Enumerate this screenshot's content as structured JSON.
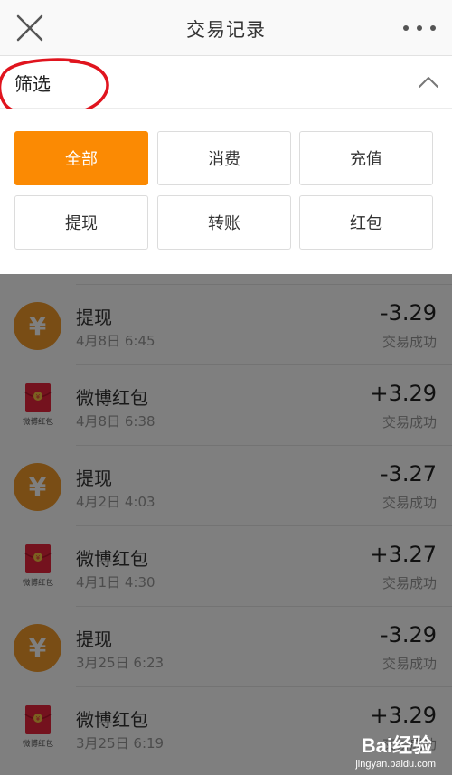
{
  "navbar": {
    "title": "交易记录",
    "close_icon": "close-icon",
    "more_icon": "more-dots-icon"
  },
  "filter": {
    "label": "筛选",
    "toggle_icon": "chevron-up-icon",
    "options": [
      "全部",
      "消费",
      "充值",
      "提现",
      "转账",
      "红包"
    ],
    "selected": "全部",
    "accent_color": "#fb8a03"
  },
  "transactions": [
    {
      "icon": "yen-icon",
      "name": "提现",
      "time": "4月8日 6:45",
      "amount": "-3.29",
      "status": "交易成功"
    },
    {
      "icon": "red-packet-icon",
      "icon_text": "微博红包",
      "name": "微博红包",
      "time": "4月8日 6:38",
      "amount": "+3.29",
      "status": "交易成功"
    },
    {
      "icon": "yen-icon",
      "name": "提现",
      "time": "4月2日 4:03",
      "amount": "-3.27",
      "status": "交易成功"
    },
    {
      "icon": "red-packet-icon",
      "icon_text": "微博红包",
      "name": "微博红包",
      "time": "4月1日 4:30",
      "amount": "+3.27",
      "status": "交易成功"
    },
    {
      "icon": "yen-icon",
      "name": "提现",
      "time": "3月25日 6:23",
      "amount": "-3.29",
      "status": "交易成功"
    },
    {
      "icon": "red-packet-icon",
      "icon_text": "微博红包",
      "name": "微博红包",
      "time": "3月25日 6:19",
      "amount": "+3.29",
      "status": "交易成功"
    }
  ],
  "watermark": {
    "logo_text": "Bai经验",
    "url": "jingyan.baidu.com"
  }
}
